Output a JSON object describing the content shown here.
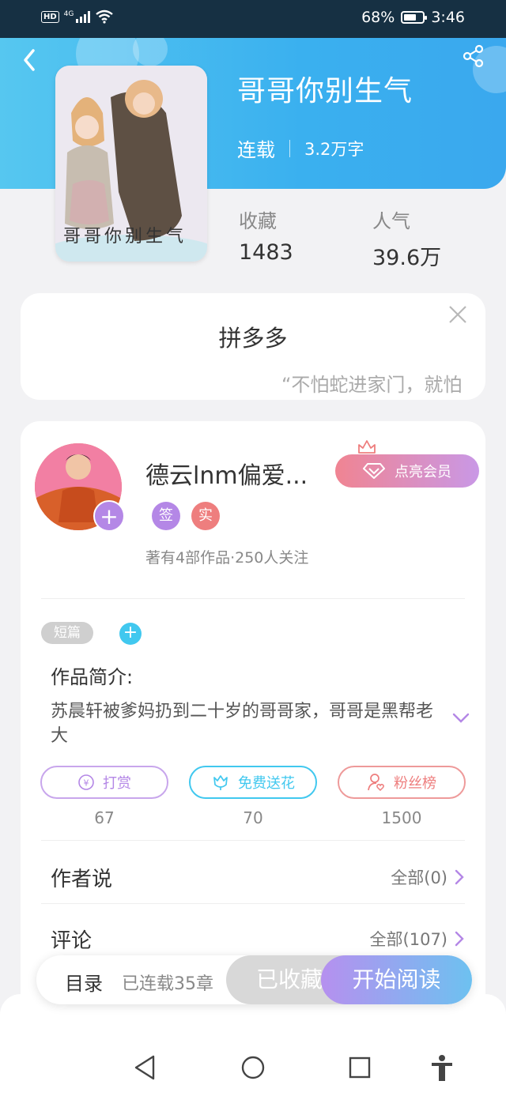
{
  "status_bar": {
    "network": "4G",
    "hd": "HD",
    "battery_text": "68%",
    "battery_level": 0.68,
    "time": "3:46"
  },
  "book": {
    "title": "哥哥你别生气",
    "status": "连载",
    "word_count": "3.2万字",
    "favorites_label": "收藏",
    "favorites_value": "1483",
    "popularity_label": "人气",
    "popularity_value": "39.6万",
    "cover_text": "哥哥你别生气"
  },
  "ad": {
    "title": "拼多多",
    "text": "“不怕蛇进家门，就怕"
  },
  "author": {
    "name": "德云lnm偏爱...",
    "badge_signed": "签",
    "badge_verified": "实",
    "meta": "著有4部作品·250人关注",
    "vip_label": "点亮会员"
  },
  "tags": {
    "short": "短篇"
  },
  "intro": {
    "label": "作品简介:",
    "text": "苏晨轩被爹妈扔到二十岁的哥哥家，哥哥是黑帮老大"
  },
  "actions": [
    {
      "label": "打赏",
      "count": "67",
      "color": "#b487e6"
    },
    {
      "label": "免费送花",
      "count": "70",
      "color": "#41c8ef"
    },
    {
      "label": "粉丝榜",
      "count": "1500",
      "color": "#ee7e7e"
    }
  ],
  "rows": {
    "author_says": {
      "label": "作者说",
      "value": "全部(0)"
    },
    "comments": {
      "label": "评论",
      "value": "全部(107)"
    }
  },
  "bottom_bar": {
    "toc": "目录",
    "chapters": "已连载35章",
    "collected": "已收藏",
    "read": "开始阅读"
  },
  "colors": {
    "header_blue": "#3ab0ef",
    "purple": "#b487e6",
    "cyan": "#41c8ef",
    "red": "#ee7e7e"
  },
  "icons": [
    "back-icon",
    "share-icon",
    "close-icon",
    "plus-icon",
    "diamond-icon",
    "crown-icon",
    "chevron-down-icon",
    "yen-icon",
    "flower-icon",
    "person-heart-icon",
    "chevron-right-icon",
    "nav-back-icon",
    "nav-home-icon",
    "nav-recents-icon",
    "accessibility-icon"
  ]
}
